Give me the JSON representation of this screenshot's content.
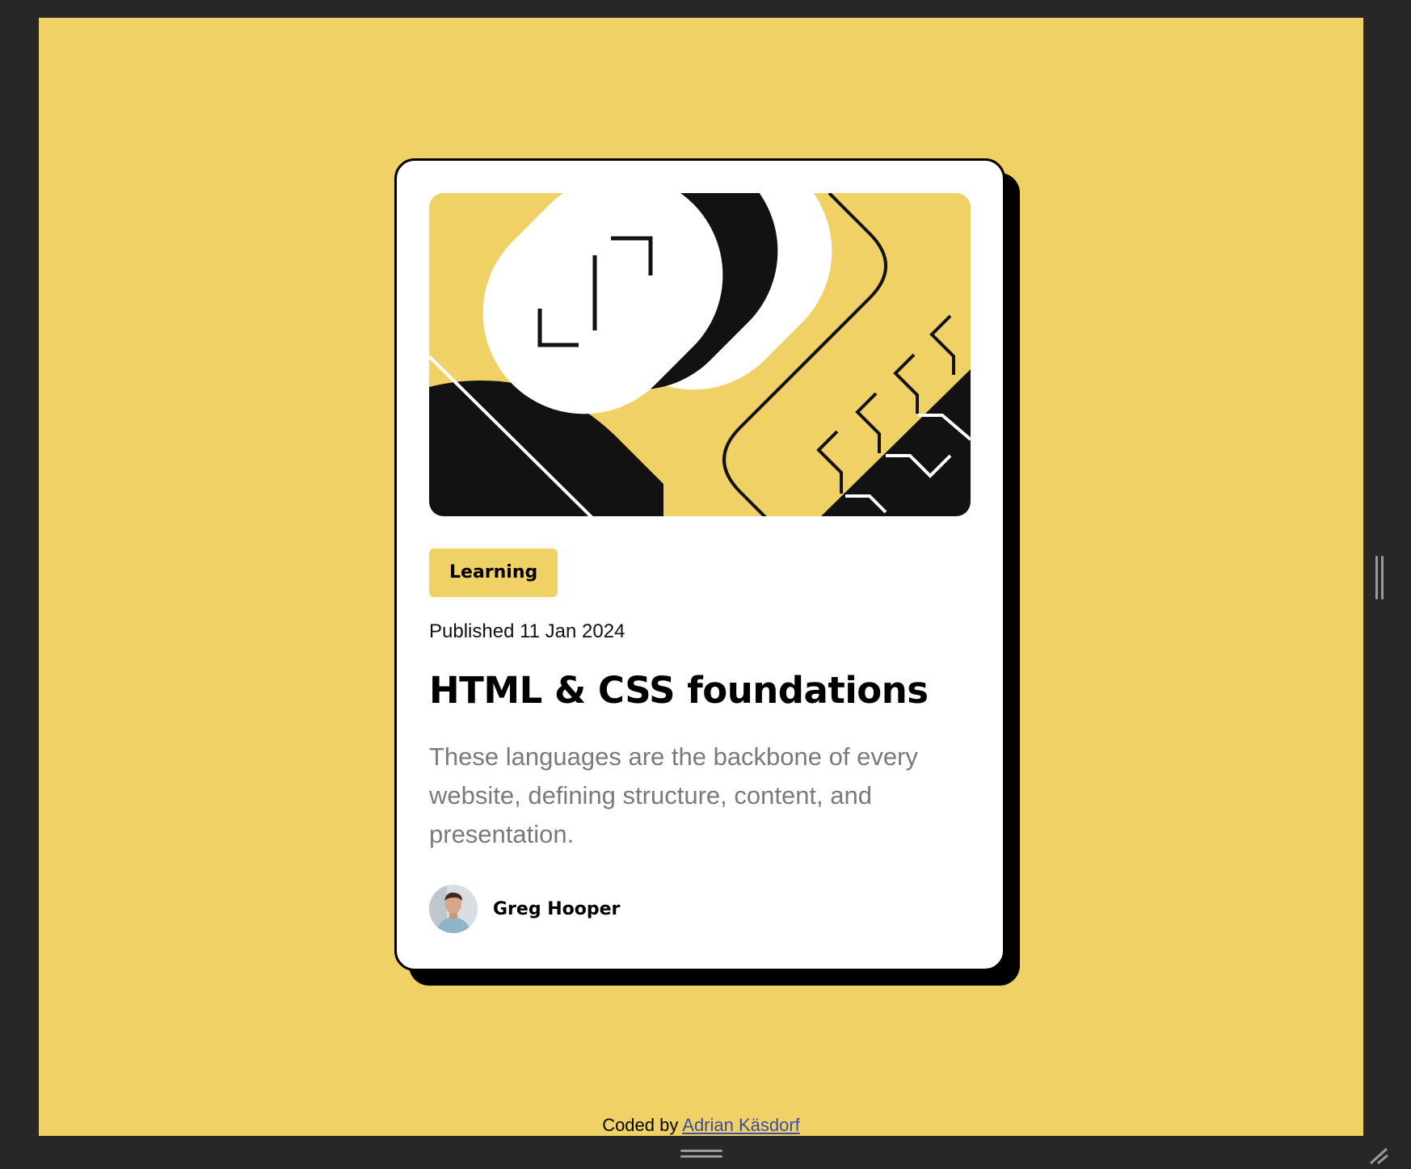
{
  "card": {
    "tag": "Learning",
    "published": "Published 11 Jan 2024",
    "title": "HTML & CSS foundations",
    "description": "These languages are the backbone of every website, defining structure, content, and presentation.",
    "author": {
      "name": "Greg Hooper",
      "avatar_icon": "avatar-photo-icon"
    },
    "illustration_icon": "abstract-illustration-icon"
  },
  "attribution": {
    "prefix": "Coded by ",
    "link_text": "Adrian Käsdorf"
  },
  "colors": {
    "page_background": "#F0D165",
    "card_background": "#FFFFFF",
    "shadow": "#000000",
    "tag_background": "#F0D165",
    "description_text": "#7A7A7A",
    "link": "#3D4DA6",
    "frame": "#272727"
  }
}
